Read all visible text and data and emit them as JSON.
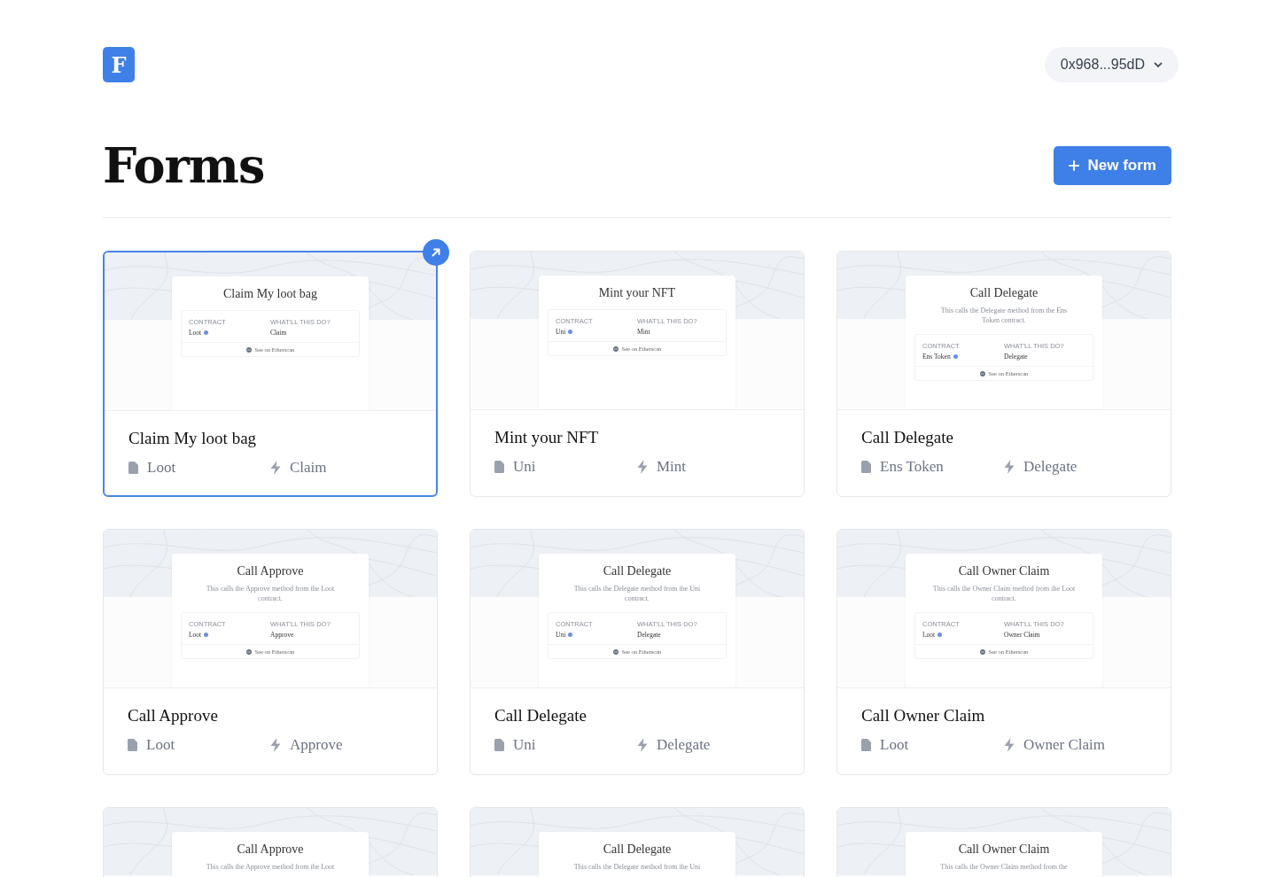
{
  "header": {
    "logo": "F",
    "account": "0x968...95dD"
  },
  "page": {
    "title": "Forms",
    "new_button": "New form"
  },
  "cards": [
    {
      "title": "Claim My loot bag",
      "contract": "Loot",
      "action": "Claim",
      "selected": true,
      "preview": {
        "title": "Claim My loot bag",
        "contract_label": "CONTRACT",
        "action_label": "WHAT'LL THIS DO?",
        "contract": "Loot",
        "action": "Claim",
        "link": "See on Etherscan"
      }
    },
    {
      "title": "Mint your NFT",
      "contract": "Uni",
      "action": "Mint",
      "selected": false,
      "preview": {
        "title": "Mint your NFT",
        "contract_label": "CONTRACT",
        "action_label": "WHAT'LL THIS DO?",
        "contract": "Uni",
        "action": "Mint",
        "link": "See on Etherscan"
      }
    },
    {
      "title": "Call Delegate",
      "contract": "Ens Token",
      "action": "Delegate",
      "selected": false,
      "preview": {
        "title": "Call Delegate",
        "description": "This calls the Delegate method from the Ens Token contract.",
        "contract_label": "CONTRACT",
        "action_label": "WHAT'LL THIS DO?",
        "contract": "Ens Token",
        "action": "Delegate",
        "link": "See on Etherscan"
      }
    },
    {
      "title": "Call Approve",
      "contract": "Loot",
      "action": "Approve",
      "selected": false,
      "preview": {
        "title": "Call Approve",
        "description": "This calls the Approve method from the Loot contract.",
        "contract_label": "CONTRACT",
        "action_label": "WHAT'LL THIS DO?",
        "contract": "Loot",
        "action": "Approve",
        "link": "See on Etherscan"
      }
    },
    {
      "title": "Call Delegate",
      "contract": "Uni",
      "action": "Delegate",
      "selected": false,
      "preview": {
        "title": "Call Delegate",
        "description": "This calls the Delegate method from the Uni contract.",
        "contract_label": "CONTRACT",
        "action_label": "WHAT'LL THIS DO?",
        "contract": "Uni",
        "action": "Delegate",
        "link": "See on Etherscan"
      }
    },
    {
      "title": "Call Owner Claim",
      "contract": "Loot",
      "action": "Owner Claim",
      "selected": false,
      "preview": {
        "title": "Call Owner Claim",
        "description": "This calls the Owner Claim method from the Loot contract.",
        "contract_label": "CONTRACT",
        "action_label": "WHAT'LL THIS DO?",
        "contract": "Loot",
        "action": "Owner Claim",
        "link": "See on Etherscan"
      }
    },
    {
      "selected": false,
      "preview": {
        "title": "Call Approve",
        "description": "This calls the Approve method from the Loot"
      }
    },
    {
      "selected": false,
      "preview": {
        "title": "Call Delegate",
        "description": "This calls the Delegate method from the Uni"
      }
    },
    {
      "selected": false,
      "preview": {
        "title": "Call Owner Claim",
        "description": "This calls the Owner Claim method from the"
      }
    }
  ]
}
